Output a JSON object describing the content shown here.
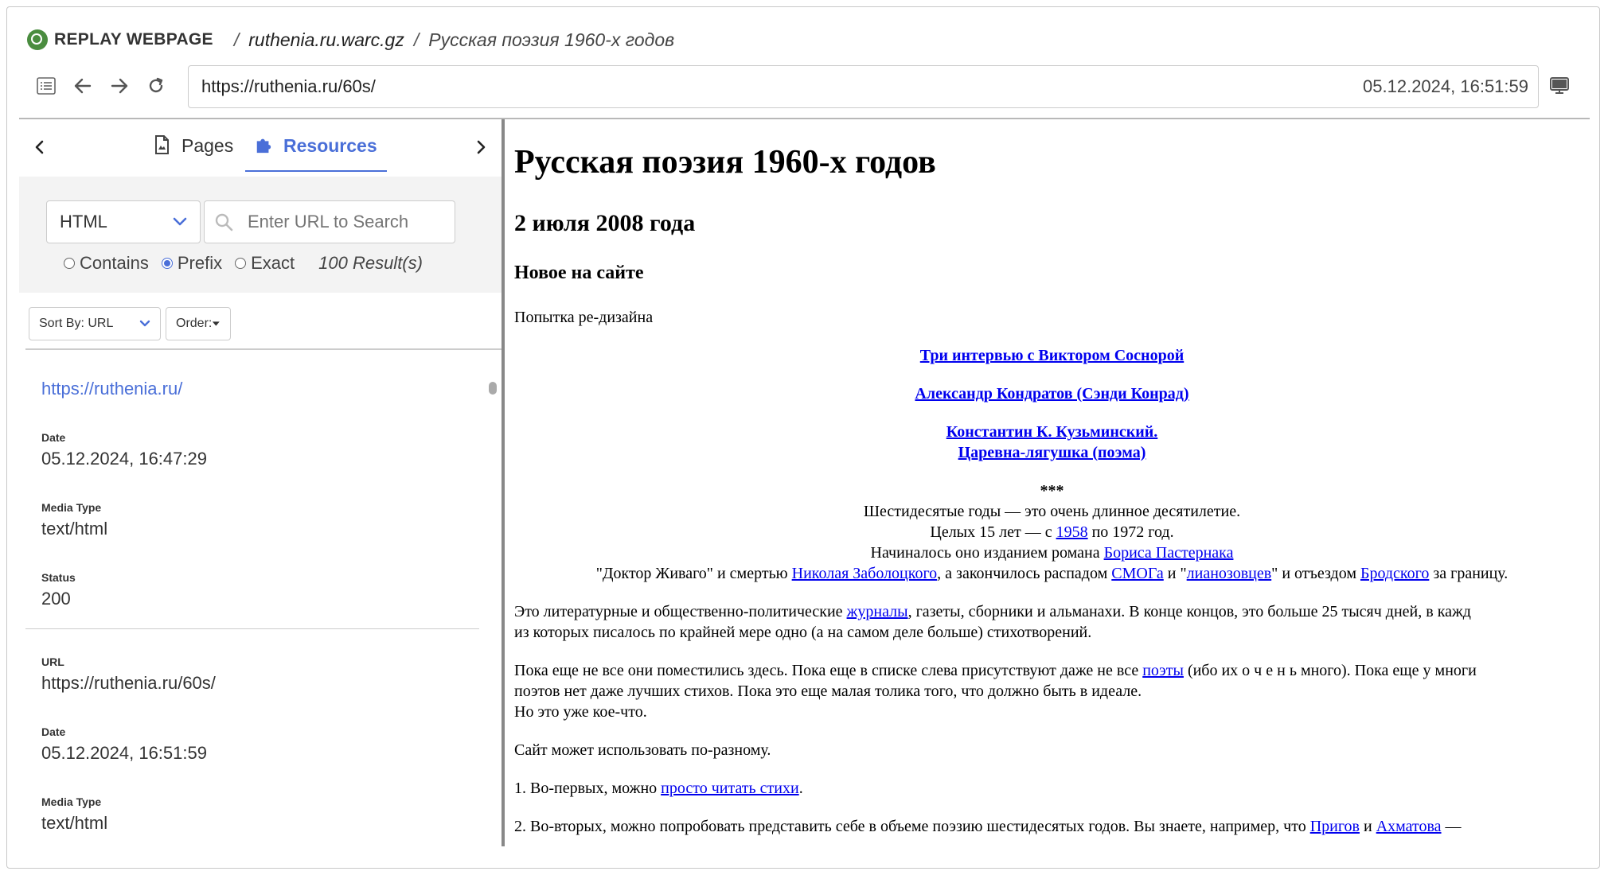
{
  "titlebar": {
    "brand": "REPLAY WEBPAGE",
    "file": "ruthenia.ru.warc.gz",
    "page_title": "Русская поэзия 1960-х годов"
  },
  "nav": {
    "url": "https://ruthenia.ru/60s/",
    "timestamp": "05.12.2024, 16:51:59"
  },
  "sidebar": {
    "tabs": [
      {
        "label": "Pages",
        "icon": "document-icon"
      },
      {
        "label": "Resources",
        "icon": "puzzle-icon"
      }
    ],
    "filter": {
      "type_selected": "HTML",
      "search_placeholder": "Enter URL to Search",
      "match_options": [
        "Contains",
        "Prefix",
        "Exact"
      ],
      "match_selected": "Prefix",
      "results": "100 Result(s)"
    },
    "sort_by": "Sort By: URL",
    "order": "Order:",
    "entries": [
      {
        "url": "https://ruthenia.ru/",
        "date_label": "Date",
        "date": "05.12.2024, 16:47:29",
        "media_label": "Media Type",
        "media": "text/html",
        "status_label": "Status",
        "status": "200"
      },
      {
        "url_label": "URL",
        "url": "https://ruthenia.ru/60s/",
        "date_label": "Date",
        "date": "05.12.2024, 16:51:59",
        "media_label": "Media Type",
        "media": "text/html"
      }
    ]
  },
  "page": {
    "h1": "Русская поэзия 1960-х годов",
    "h2": "2 июля 2008 года",
    "h3": "Новое на сайте",
    "redesign": "Попытка ре-дизайна",
    "link1": "Три интервью с Виктором Соснорой",
    "link2": "Александр Кондратов (Сэнди Конрад)",
    "link3a": "Константин К. Кузьминский.",
    "link3b": "Царевна-лягушка (поэма)",
    "stars": "***",
    "c1": "Шестидесятые годы — это очень длинное десятилетие.",
    "c2a": "Целых 15 лет — с ",
    "c2link": "1958",
    "c2b": " по 1972 год.",
    "c3a": "Начиналось оно изданием романа ",
    "c3link": "Бориса Пастернака",
    "c4a": "\"Доктор Живаго\" и смертью ",
    "c4link1": "Николая Заболоцкого",
    "c4b": ", а закончилось распадом ",
    "c4link2": "СМОГа",
    "c4c": " и \"",
    "c4link3": "лианозовцев",
    "c4d": "\" и отъездом ",
    "c4link4": "Бродского",
    "c4e": " за границу.",
    "p1a": "Это литературные и общественно-политические ",
    "p1link": "журналы",
    "p1b": ", газеты, сборники и альманахи. В конце концов, это больше 25 тысяч дней, в кажд",
    "p1c": "из которых писалось по крайней мере одно (а на самом деле больше) стихотворений.",
    "p2a": "Пока еще не все они поместились здесь. Пока еще в списке слева присутствуют даже не все ",
    "p2link": "поэты",
    "p2b": " (ибо их о ч е н ь  много). Пока еще у многи",
    "p2c": "поэтов нет даже лучших стихов. Пока это еще малая толика того, что должно быть в идеале.",
    "p2d": "Но это уже кое-что.",
    "p3": "Сайт может использовать по-разному.",
    "p4a": "1. Во-первых, можно ",
    "p4link": "просто читать стихи",
    "p4b": ".",
    "p5a": "2. Во-вторых, можно попробовать представить себе в объеме поэзию шестидесятых годов. Вы знаете, например, что ",
    "p5link1": "Пригов",
    "p5b": " и ",
    "p5link2": "Ахматова",
    "p5c": " —"
  }
}
